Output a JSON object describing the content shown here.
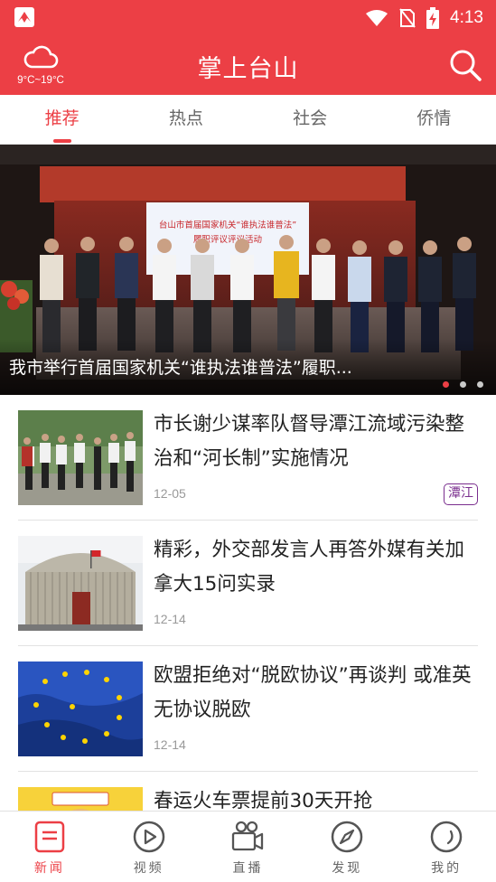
{
  "status_bar": {
    "time": "4:13"
  },
  "header": {
    "weather_temp": "9°C~19°C",
    "title": "掌上台山",
    "search_icon": "search-icon"
  },
  "tabs": [
    {
      "label": "推荐",
      "active": true
    },
    {
      "label": "热点",
      "active": false
    },
    {
      "label": "社会",
      "active": false
    },
    {
      "label": "侨情",
      "active": false
    }
  ],
  "banner": {
    "caption": "我市举行首届国家机关“谁执法谁普法”履职...",
    "slides": 3,
    "active_slide": 1,
    "backdrop_line1": "台山市首届国家机关“谁执法谁普法”",
    "backdrop_line2": "履职评议评议活动"
  },
  "news": [
    {
      "title": "市长谢少谋率队督导潭江流域污染整治和“河长制”实施情况",
      "date": "12-05",
      "tag": "潭江"
    },
    {
      "title": "精彩，外交部发言人再答外媒有关加拿大15问实录",
      "date": "12-14",
      "tag": ""
    },
    {
      "title": "欧盟拒绝对“脱欧协议”再谈判 或准英无协议脱欧",
      "date": "12-14",
      "tag": ""
    },
    {
      "title": "春运火车票提前30天开抢",
      "date": "",
      "tag": ""
    }
  ],
  "bottom_nav": [
    {
      "label": "新闻",
      "icon": "news-icon",
      "active": true
    },
    {
      "label": "视频",
      "icon": "play-icon",
      "active": false
    },
    {
      "label": "直播",
      "icon": "camera-icon",
      "active": false
    },
    {
      "label": "发现",
      "icon": "compass-icon",
      "active": false
    },
    {
      "label": "我的",
      "icon": "profile-icon",
      "active": false
    }
  ],
  "colors": {
    "brand": "#ec3f45",
    "tag": "#7a2e8e"
  }
}
